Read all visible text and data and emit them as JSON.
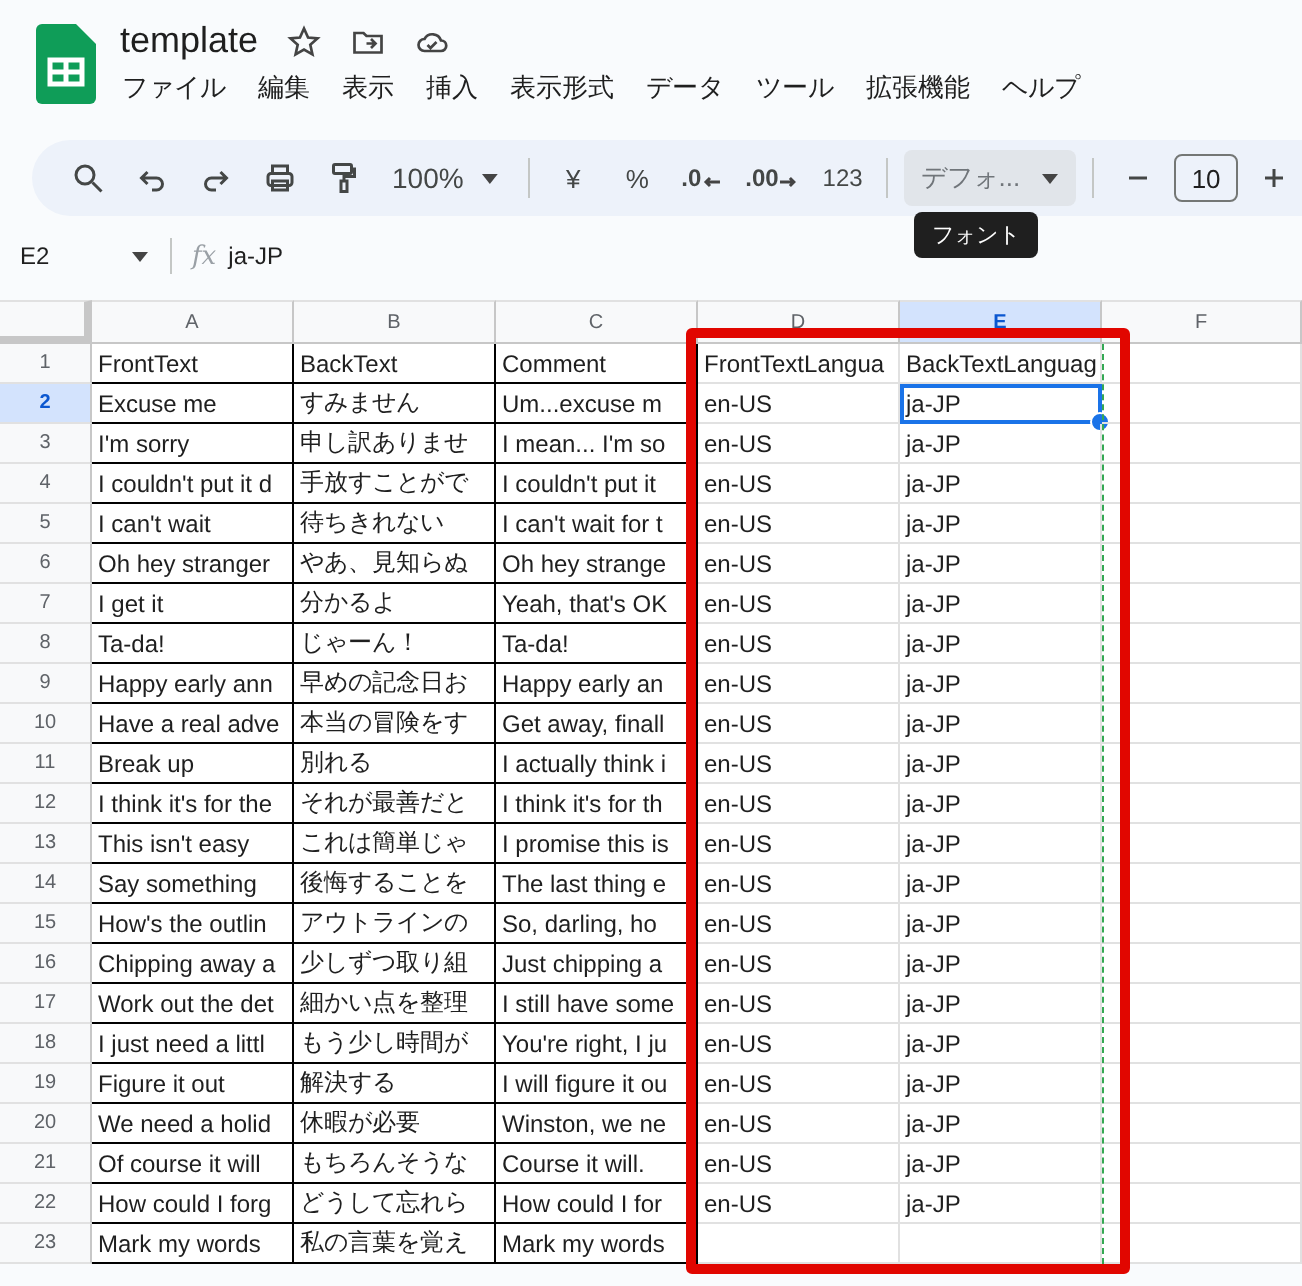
{
  "document": {
    "title": "template"
  },
  "menu": [
    "ファイル",
    "編集",
    "表示",
    "挿入",
    "表示形式",
    "データ",
    "ツール",
    "拡張機能",
    "ヘルプ"
  ],
  "toolbar": {
    "zoom": "100%",
    "currency": "¥",
    "percent": "%",
    "decrease_decimal": ".0",
    "increase_decimal": ".00",
    "number_format": "123",
    "font": "デフォ...",
    "font_size": "10",
    "tooltip": "フォント"
  },
  "formula_bar": {
    "name_box": "E2",
    "function_label": "fx",
    "formula": "ja-JP"
  },
  "columns": [
    {
      "label": "A",
      "selected": false
    },
    {
      "label": "B",
      "selected": false
    },
    {
      "label": "C",
      "selected": false
    },
    {
      "label": "D",
      "selected": false
    },
    {
      "label": "E",
      "selected": true
    },
    {
      "label": "F",
      "selected": false
    }
  ],
  "rows": [
    {
      "number": "1",
      "selected": false,
      "cells": [
        "FrontText",
        "BackText",
        "Comment",
        "FrontTextLangua",
        "BackTextLanguag"
      ]
    },
    {
      "number": "2",
      "selected": true,
      "cells": [
        "Excuse me",
        "すみません",
        "Um...excuse m",
        "en-US",
        "ja-JP"
      ]
    },
    {
      "number": "3",
      "selected": false,
      "cells": [
        "I'm sorry",
        "申し訳ありませ",
        "I mean... I'm so",
        "en-US",
        "ja-JP"
      ]
    },
    {
      "number": "4",
      "selected": false,
      "cells": [
        "I couldn't put it d",
        "手放すことがで",
        "I couldn't put it",
        "en-US",
        "ja-JP"
      ]
    },
    {
      "number": "5",
      "selected": false,
      "cells": [
        "I can't wait",
        "待ちきれない",
        "I can't wait for t",
        "en-US",
        "ja-JP"
      ]
    },
    {
      "number": "6",
      "selected": false,
      "cells": [
        "Oh hey stranger",
        "やあ、見知らぬ",
        "Oh hey strange",
        "en-US",
        "ja-JP"
      ]
    },
    {
      "number": "7",
      "selected": false,
      "cells": [
        "I get it",
        "分かるよ",
        "Yeah, that's OK",
        "en-US",
        "ja-JP"
      ]
    },
    {
      "number": "8",
      "selected": false,
      "cells": [
        "Ta-da!",
        "じゃーん！",
        "Ta-da!",
        "en-US",
        "ja-JP"
      ]
    },
    {
      "number": "9",
      "selected": false,
      "cells": [
        "Happy early ann",
        "早めの記念日お",
        "Happy early an",
        "en-US",
        "ja-JP"
      ]
    },
    {
      "number": "10",
      "selected": false,
      "cells": [
        "Have a real adve",
        "本当の冒険をす",
        "Get away, finall",
        "en-US",
        "ja-JP"
      ]
    },
    {
      "number": "11",
      "selected": false,
      "cells": [
        "Break up",
        "別れる",
        "I actually think i",
        "en-US",
        "ja-JP"
      ]
    },
    {
      "number": "12",
      "selected": false,
      "cells": [
        "I think it's for the",
        "それが最善だと",
        "I think it's for th",
        "en-US",
        "ja-JP"
      ]
    },
    {
      "number": "13",
      "selected": false,
      "cells": [
        "This isn't easy",
        "これは簡単じゃ",
        "I promise this is",
        "en-US",
        "ja-JP"
      ]
    },
    {
      "number": "14",
      "selected": false,
      "cells": [
        "Say something",
        "後悔することを",
        "The last thing e",
        "en-US",
        "ja-JP"
      ]
    },
    {
      "number": "15",
      "selected": false,
      "cells": [
        "How's the outlin",
        "アウトラインの",
        "So, darling, ho",
        "en-US",
        "ja-JP"
      ]
    },
    {
      "number": "16",
      "selected": false,
      "cells": [
        "Chipping away a",
        "少しずつ取り組",
        "Just chipping a",
        "en-US",
        "ja-JP"
      ]
    },
    {
      "number": "17",
      "selected": false,
      "cells": [
        "Work out the det",
        "細かい点を整理",
        "I still have some",
        "en-US",
        "ja-JP"
      ]
    },
    {
      "number": "18",
      "selected": false,
      "cells": [
        "I just need a littl",
        "もう少し時間が",
        "You're right, I ju",
        "en-US",
        "ja-JP"
      ]
    },
    {
      "number": "19",
      "selected": false,
      "cells": [
        "Figure it out",
        "解決する",
        "I will figure it ou",
        "en-US",
        "ja-JP"
      ]
    },
    {
      "number": "20",
      "selected": false,
      "cells": [
        "We need a holid",
        "休暇が必要",
        "Winston, we ne",
        "en-US",
        "ja-JP"
      ]
    },
    {
      "number": "21",
      "selected": false,
      "cells": [
        "Of course it will",
        "もちろんそうな",
        "Course it will.",
        "en-US",
        "ja-JP"
      ]
    },
    {
      "number": "22",
      "selected": false,
      "cells": [
        "How could I forg",
        "どうして忘れら",
        "How could I for",
        "en-US",
        "ja-JP"
      ]
    },
    {
      "number": "23",
      "selected": false,
      "cells": [
        "Mark my words",
        "私の言葉を覚え",
        "Mark my words"
      ]
    }
  ]
}
